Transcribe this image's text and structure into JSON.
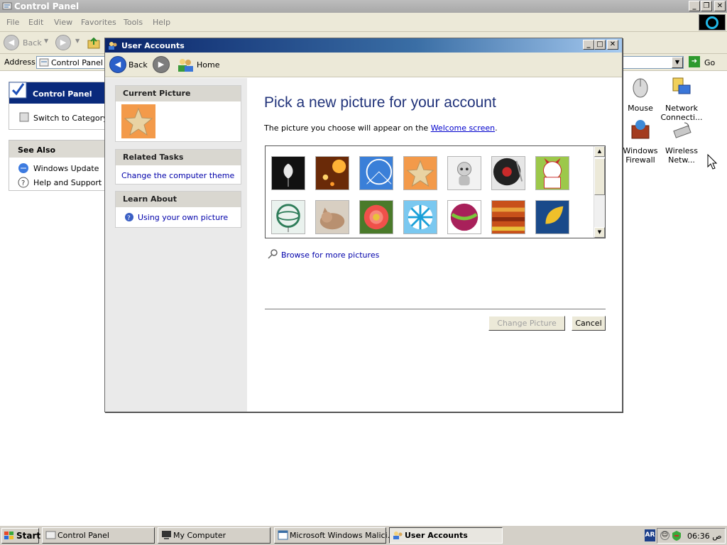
{
  "control_panel": {
    "title": "Control Panel",
    "menu": [
      "File",
      "Edit",
      "View",
      "Favorites",
      "Tools",
      "Help"
    ],
    "toolbar": {
      "back_label": "Back"
    },
    "address": {
      "label": "Address",
      "value": "Control Panel",
      "go_label": "Go"
    },
    "left_panel": {
      "title": "Control Panel",
      "switch_link": "Switch to Category V",
      "see_also_title": "See Also",
      "see_also": [
        "Windows Update",
        "Help and Support"
      ]
    },
    "icons": [
      {
        "label": "Mouse",
        "icon": "mouse-icon"
      },
      {
        "label": "Network Connecti...",
        "icon": "network-icon"
      },
      {
        "label": "Windows Firewall",
        "icon": "firewall-icon"
      },
      {
        "label": "Wireless Netw...",
        "icon": "wireless-icon"
      }
    ]
  },
  "user_accounts": {
    "title": "User Accounts",
    "nav": {
      "back_label": "Back",
      "home_label": "Home"
    },
    "current_picture_title": "Current Picture",
    "related_tasks_title": "Related Tasks",
    "related_tasks": [
      "Change the computer theme"
    ],
    "learn_about_title": "Learn About",
    "learn_about": [
      "Using your own picture"
    ],
    "heading": "Pick a new picture for your account",
    "subtext_before": "The picture you choose will appear on the ",
    "subtext_link": "Welcome screen",
    "subtext_after": ".",
    "pictures": [
      "flower",
      "sparkle",
      "ferris-wheel",
      "starfish",
      "robot",
      "turntable",
      "lucky-cat",
      "gyroscope",
      "kitten",
      "daisy",
      "pinwheel",
      "ball",
      "fabric",
      "leaf"
    ],
    "browse_label": "Browse for more pictures",
    "change_button": "Change Picture",
    "cancel_button": "Cancel"
  },
  "taskbar": {
    "start_label": "Start",
    "tasks": [
      "Control Panel",
      "My Computer",
      "Microsoft Windows Malici...",
      "User Accounts"
    ],
    "language": "AR",
    "time": "06:36 ص"
  },
  "colors": {
    "heading": "#21337a",
    "link": "#0000cc",
    "title_bar": "#0a246a"
  }
}
